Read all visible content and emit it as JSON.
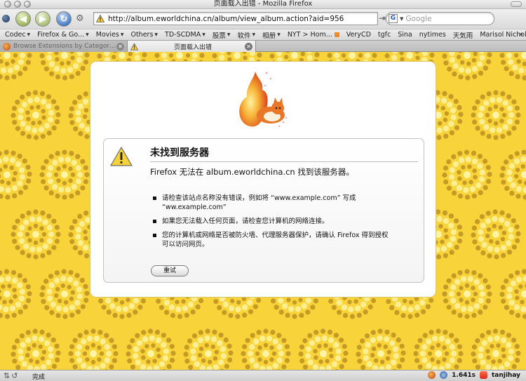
{
  "window": {
    "title": "页面载入出错 - Mozilla Firefox"
  },
  "navbar": {
    "url": "http://album.eworldchina.cn/album/view_album.action?aid=956",
    "search_placeholder": "Google",
    "search_engine_icon": "G"
  },
  "bookmarks": [
    {
      "label": "Codec",
      "folder": true
    },
    {
      "label": "Firefox & Go...",
      "folder": true
    },
    {
      "label": "Movies",
      "folder": true
    },
    {
      "label": "Others",
      "folder": true
    },
    {
      "label": "TD-SCDMA",
      "folder": true
    },
    {
      "label": "股票",
      "folder": true
    },
    {
      "label": "软件",
      "folder": true
    },
    {
      "label": "相册",
      "folder": true
    },
    {
      "label": "NYT > Hom...",
      "folder": false,
      "rss": true
    },
    {
      "label": "VeryCD",
      "folder": false
    },
    {
      "label": "tgfc",
      "folder": false
    },
    {
      "label": "Sina",
      "folder": false
    },
    {
      "label": "nytimes",
      "folder": false
    },
    {
      "label": "天気雨",
      "folder": false
    },
    {
      "label": "Marisol Nichols",
      "folder": false
    }
  ],
  "bookmarks_more": "»",
  "tabs": [
    {
      "label": "Browse Extensions by Category :...",
      "active": false
    },
    {
      "label": "页面载入出错",
      "active": true
    }
  ],
  "error": {
    "title": "未找到服务器",
    "summary": "Firefox 无法在 album.eworldchina.cn 找到该服务器。",
    "items": [
      "请检查该站点名称没有错误，例如将 “www.example.com” 写成 “ww.example.com”",
      "如果您无法载入任何页面，请检查您计算机的网络连接。",
      "您的计算机或网络是否被防火墙、代理服务器保护，请确认 Firefox 得到授权可以访问网页。"
    ],
    "retry_label": "重试"
  },
  "status": {
    "text": "完成",
    "timer": "1.641s",
    "user": "tanjihay"
  },
  "colors": {
    "background": "#f8d43a",
    "dots_dark": "#b38a1f",
    "dots_light": "#fff7b0",
    "warning": "#f6d23a"
  }
}
